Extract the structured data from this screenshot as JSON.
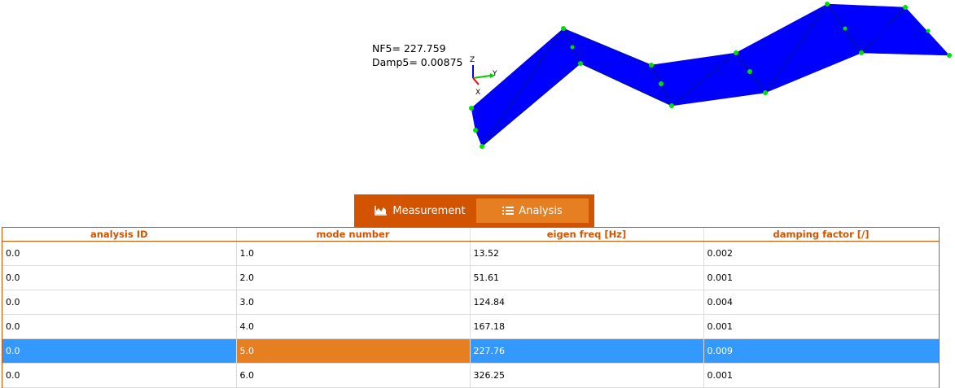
{
  "viewport": {
    "mode_info": {
      "freq_line": "NF5= 227.759",
      "damp_line": "Damp5= 0.00875"
    },
    "axes": {
      "z": "Z",
      "y": "Y",
      "x": "X"
    },
    "colors": {
      "surface": "#0000ff",
      "nodes": "#00dd00",
      "axis_y": "#00cc00",
      "axis_z": "#0000ff",
      "axis_x": "#ff0000"
    }
  },
  "tabs": [
    {
      "label": "Measurement",
      "icon": "area-chart-icon",
      "active": true
    },
    {
      "label": "Analysis",
      "icon": "list-icon",
      "active": false
    }
  ],
  "table": {
    "headers": [
      "analysis ID",
      "mode number",
      "eigen freq [Hz]",
      "damping factor [/]"
    ],
    "rows": [
      [
        "0.0",
        "1.0",
        "13.52",
        "0.002"
      ],
      [
        "0.0",
        "2.0",
        "51.61",
        "0.001"
      ],
      [
        "0.0",
        "3.0",
        "124.84",
        "0.004"
      ],
      [
        "0.0",
        "4.0",
        "167.18",
        "0.001"
      ],
      [
        "0.0",
        "5.0",
        "227.76",
        "0.009"
      ],
      [
        "0.0",
        "6.0",
        "326.25",
        "0.001"
      ]
    ],
    "selected_row": 5,
    "current_cell_column": "mode number"
  },
  "colors": {
    "accent": "#d35400",
    "tab_light": "#e67e22",
    "selection": "#3399ff"
  }
}
